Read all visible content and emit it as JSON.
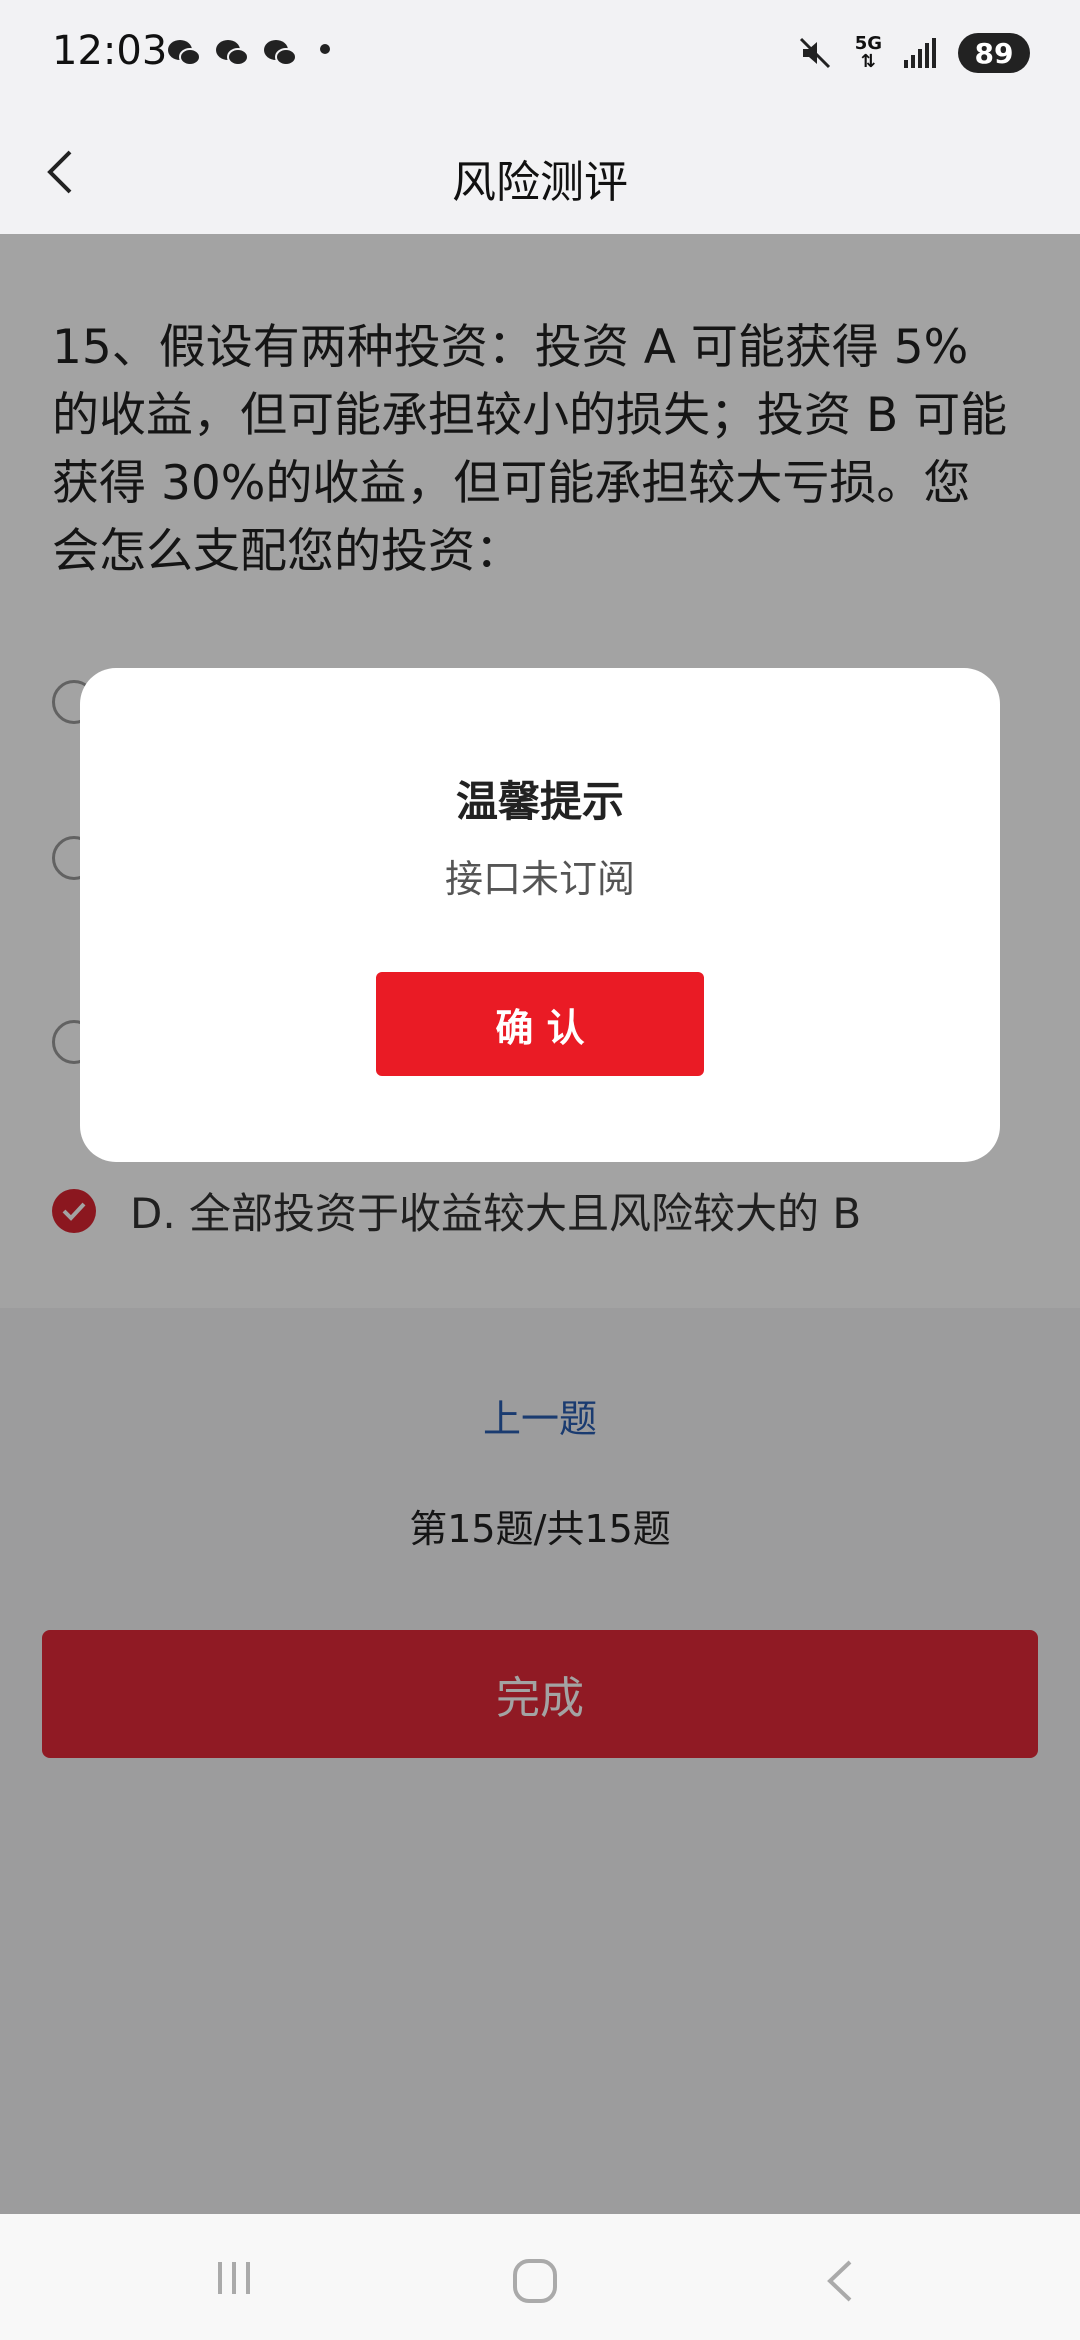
{
  "status_bar": {
    "time": "12:03",
    "icons": [
      "wechat-icon",
      "wechat-icon",
      "wechat-icon",
      "mute-icon",
      "signal-icon"
    ],
    "network": "5G",
    "battery": "89"
  },
  "nav": {
    "title": "风险测评",
    "back_icon": "chevron-left-icon"
  },
  "question": {
    "text": "15、假设有两种投资：投资 A 可能获得 5% 的收益，但可能承担较小的损失；投资 B 可能获得 30%的收益，但可能承担较大亏损。您会怎么支配您的投资："
  },
  "options": [
    {
      "label": "",
      "selected": false
    },
    {
      "label": "",
      "selected": false
    },
    {
      "label": "",
      "selected": false
    },
    {
      "label": "D.  全部投资于收益较大且风险较大的 B",
      "selected": true
    }
  ],
  "footer": {
    "prev_label": "上一题",
    "page_indicator": "第15题/共15题",
    "finish_label": "完成"
  },
  "dialog": {
    "title": "温馨提示",
    "message": "接口未订阅",
    "confirm_label": "确 认"
  },
  "colors": {
    "accent_red": "#ea1b25",
    "finish_red": "#e12a39",
    "link_blue": "#2a5db0",
    "overlay": "rgba(0,0,0,0.36)"
  }
}
